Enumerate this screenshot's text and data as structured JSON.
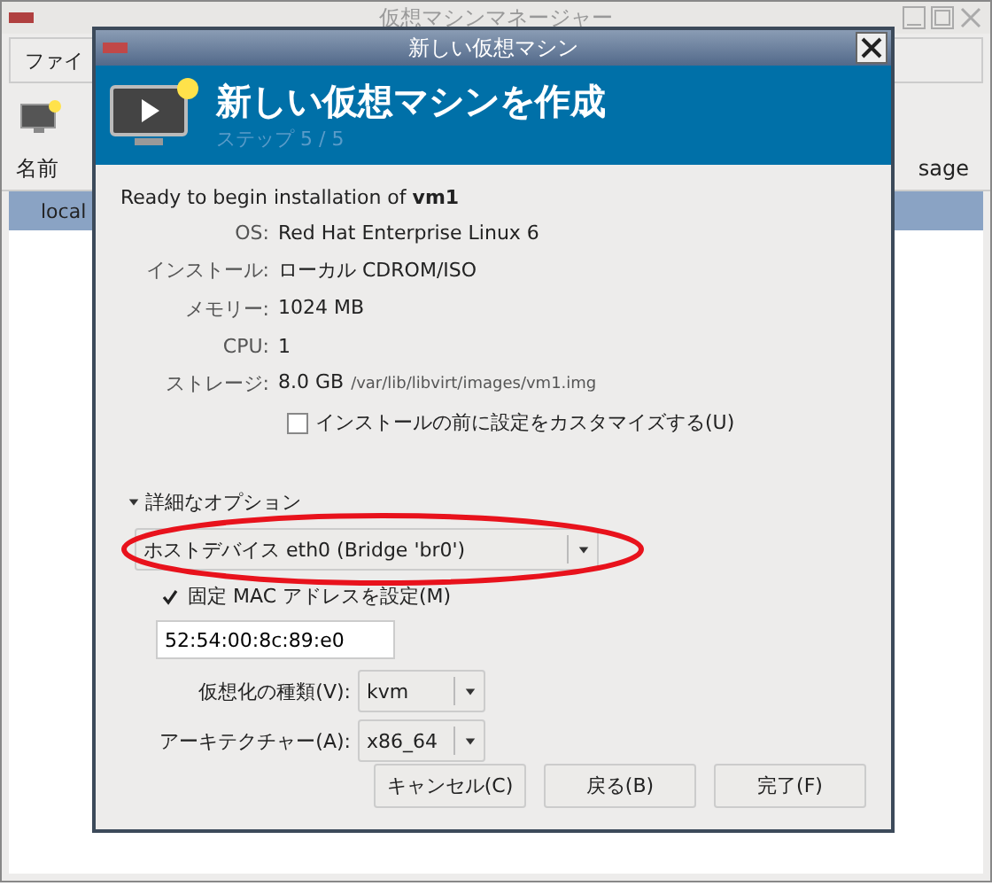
{
  "main_window": {
    "title": "仮想マシンマネージャー",
    "menu": [
      "ファイ"
    ],
    "columns": [
      "名前",
      "sage"
    ],
    "rows": [
      {
        "name": "local",
        "selected": true
      }
    ]
  },
  "dialog": {
    "title": "新しい仮想マシン",
    "heading": "新しい仮想マシンを作成",
    "step": "ステップ 5 / 5",
    "summary": "Ready to begin installation of **vm1**",
    "details": [
      {
        "label": "OS:",
        "value": "Red Hat Enterprise Linux 6"
      },
      {
        "label": "インストール:",
        "value": "ローカル CDROM/ISO"
      },
      {
        "label": "メモリー:",
        "value": "1024 MB"
      },
      {
        "label": "CPU:",
        "value": "1"
      },
      {
        "label": "ストレージ:",
        "value": "8.0 GB",
        "note": "/var/lib/libvirt/images/vm1.img"
      }
    ],
    "customize": {
      "label": "インストールの前に設定をカスタマイズする(U)",
      "checked": false
    },
    "advanced": {
      "label": "詳細なオプション",
      "expanded": true,
      "network": "ホストデバイス eth0 (Bridge 'br0')",
      "highlighted": true,
      "mac": {
        "label": "固定 MAC アドレスを設定(M)",
        "checked": true,
        "value": "52:54:00:8c:89:e0"
      },
      "selects": [
        {
          "label": "仮想化の種類(V):",
          "value": "kvm"
        },
        {
          "label": "アーキテクチャー(A):",
          "value": "x86_64"
        }
      ]
    },
    "buttons": [
      "キャンセル(C)",
      "戻る(B)",
      "完了(F)"
    ]
  }
}
